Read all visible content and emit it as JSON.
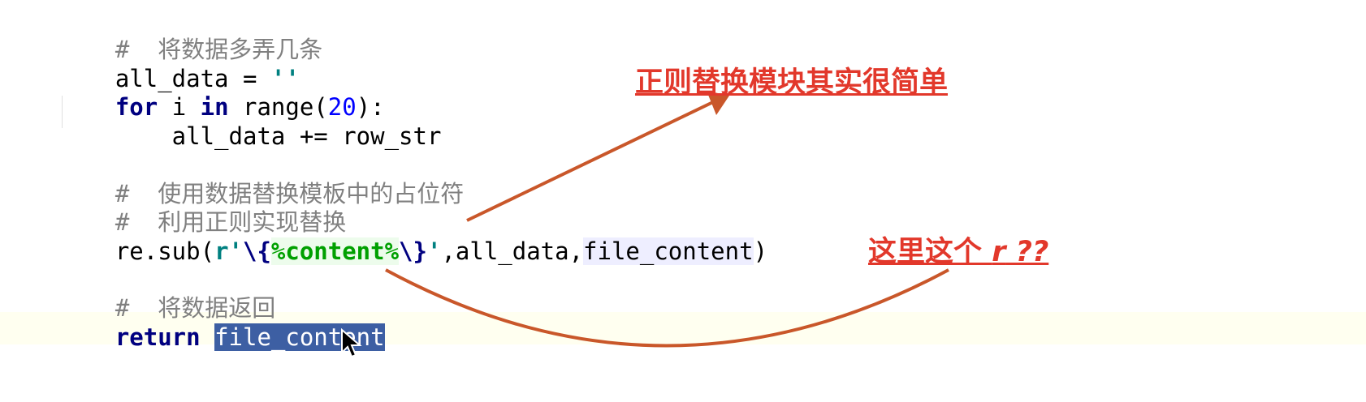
{
  "code": {
    "line1_comment": "#  将数据多弄几条",
    "line2": {
      "var": "all_data",
      "op": " = ",
      "str": "''"
    },
    "line3": {
      "kw_for": "for",
      "var_i": " i ",
      "kw_in": "in",
      "fn": " range(",
      "num": "20",
      "end": "):"
    },
    "line4": "    all_data += row_str",
    "line5_comment": "#  使用数据替换模板中的占位符",
    "line6_comment": "#  利用正则实现替换",
    "line7": {
      "fn": "re.sub(",
      "prefix": "r'",
      "esc_open": "\\{",
      "regex": "%content%",
      "esc_close": "\\}",
      "quote": "'",
      "args": ",all_data,",
      "arg3": "file_content",
      "close": ")"
    },
    "line8_comment": "#  将数据返回",
    "line9": {
      "kw_return": "return",
      "space": " ",
      "selected": "file_content"
    }
  },
  "annotations": {
    "top": "正则替换模块其实很简单",
    "right_prefix": "这里这个 ",
    "right_r": "r",
    "right_suffix": " ??"
  },
  "colors": {
    "annotation": "#e2382b",
    "arrow": "#c9572a",
    "selection": "#3d5fa3"
  },
  "icons": {
    "cursor": "mouse-pointer-icon"
  }
}
